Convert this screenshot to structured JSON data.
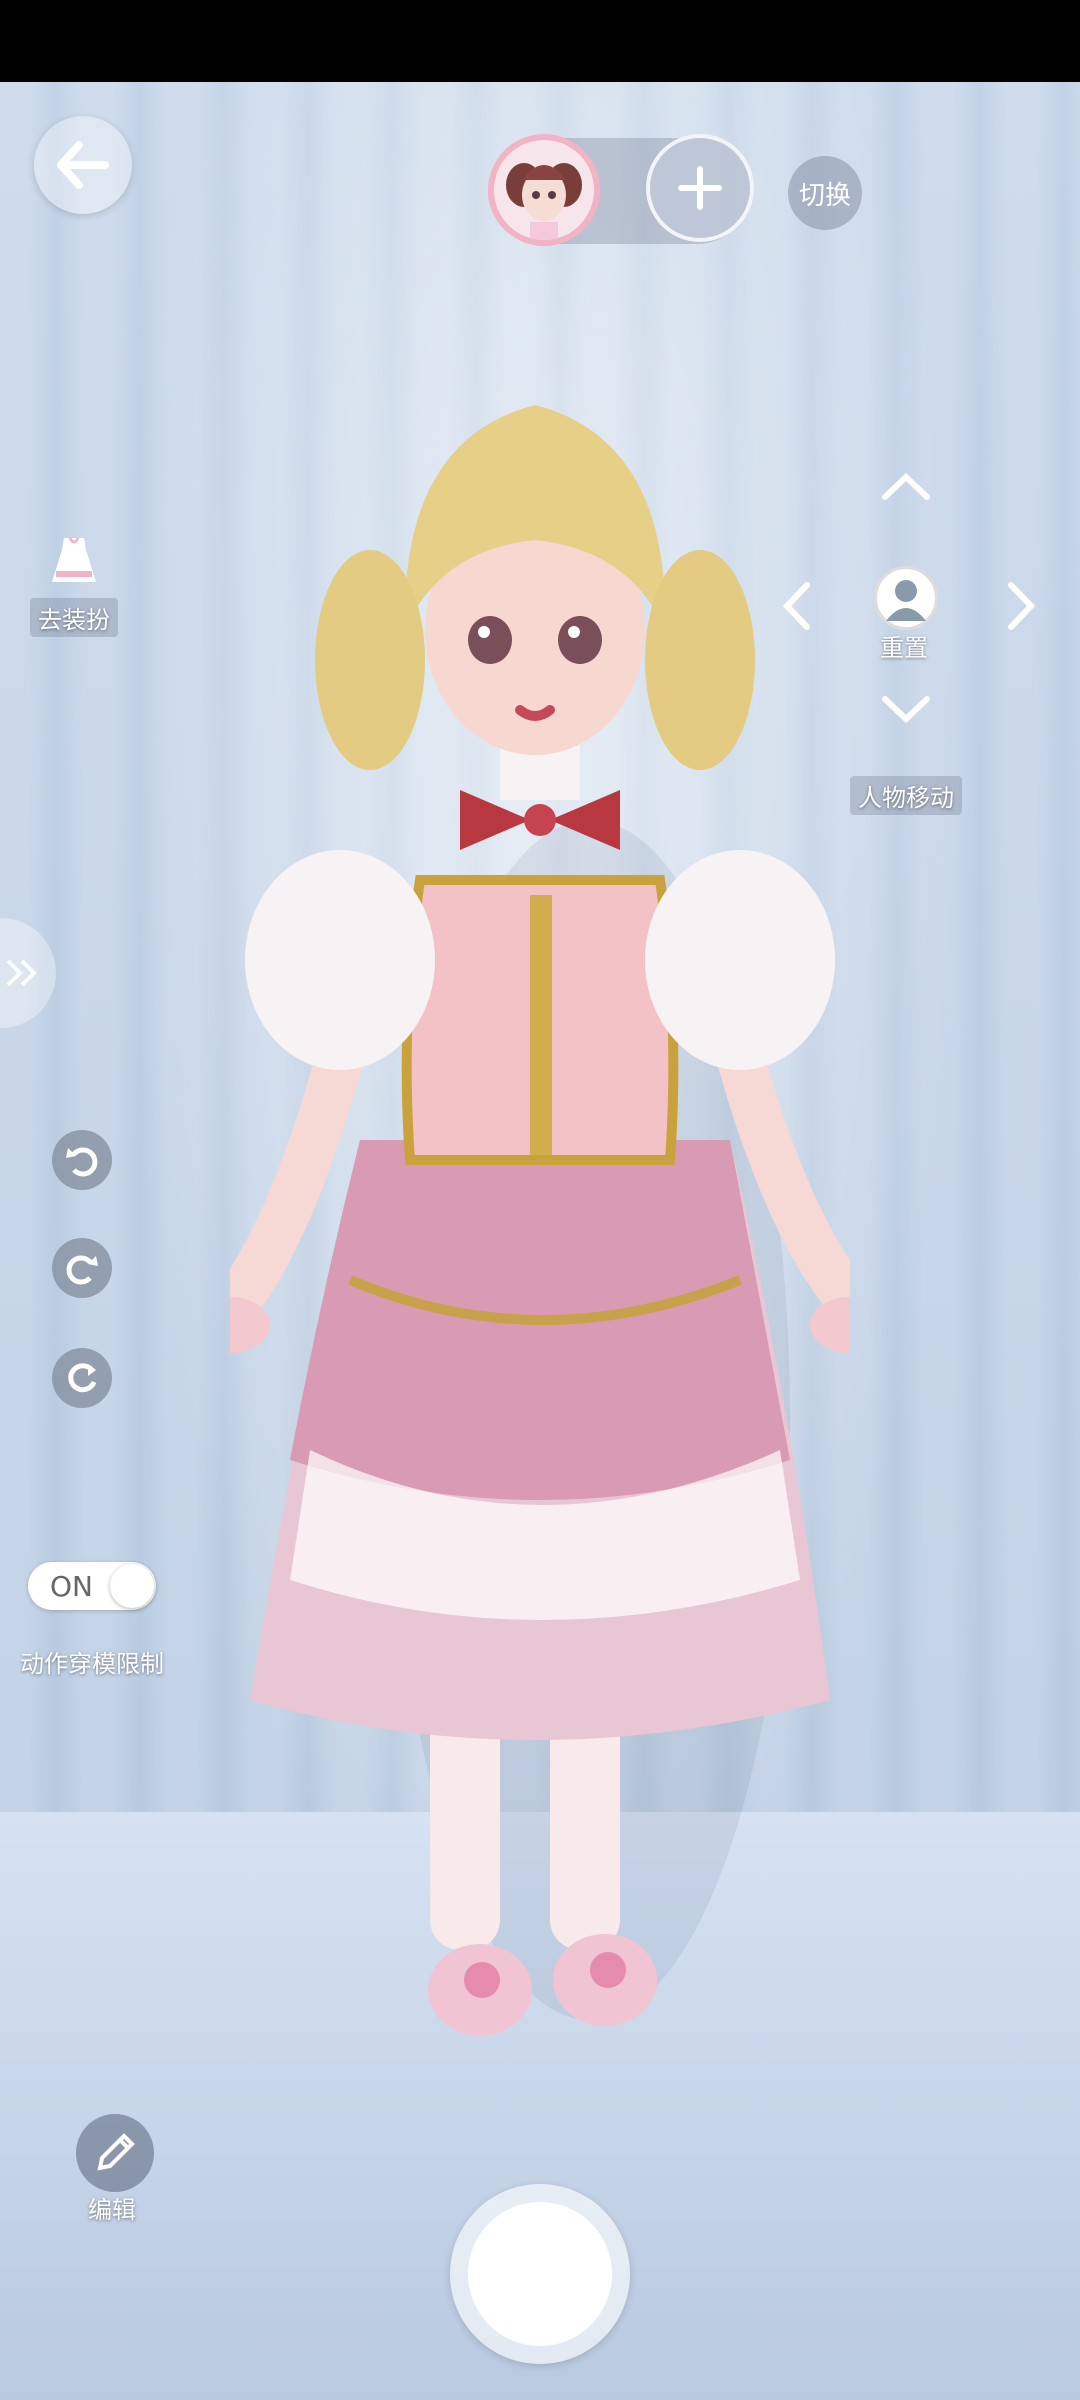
{
  "toolbar": {
    "switch_label": "切换",
    "remove_outfit_label": "去装扮",
    "reset_label": "重置",
    "character_move_label": "人物移动",
    "clip_limit_label": "动作穿模限制",
    "toggle_state": "ON",
    "edit_label": "编辑"
  },
  "icons": {
    "back": "back-arrow-icon",
    "add": "plus-icon",
    "dress": "dress-icon",
    "person": "person-icon",
    "undo": "undo-icon",
    "redo": "redo-icon",
    "refresh": "refresh-icon",
    "edit": "pencil-icon",
    "expand": "double-chevron-right-icon"
  },
  "colors": {
    "accent_pink": "#f2b3c5",
    "stage_blue": "#c9d8ea"
  }
}
